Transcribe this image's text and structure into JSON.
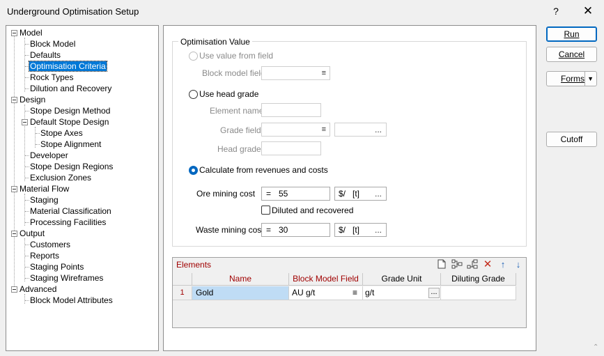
{
  "window": {
    "title": "Underground Optimisation Setup",
    "help_label": "?",
    "close_label": "✕"
  },
  "tree": {
    "model": "Model",
    "block_model": "Block Model",
    "defaults": "Defaults",
    "optimisation_criteria": "Optimisation Criteria",
    "rock_types": "Rock Types",
    "dilution_and_recovery": "Dilution and Recovery",
    "design": "Design",
    "stope_design_method": "Stope Design Method",
    "default_stope_design": "Default Stope Design",
    "stope_axes": "Stope Axes",
    "stope_alignment": "Stope Alignment",
    "developer": "Developer",
    "stope_design_regions": "Stope Design Regions",
    "exclusion_zones": "Exclusion Zones",
    "material_flow": "Material Flow",
    "staging": "Staging",
    "material_classification": "Material Classification",
    "processing_facilities": "Processing Facilities",
    "output": "Output",
    "customers": "Customers",
    "reports": "Reports",
    "staging_points": "Staging Points",
    "staging_wireframes": "Staging Wireframes",
    "advanced": "Advanced",
    "block_model_attributes": "Block Model Attributes"
  },
  "optimisation": {
    "group_title": "Optimisation Value",
    "use_value_from_field": "Use value from field",
    "block_model_field_label": "Block model field",
    "use_head_grade": "Use head grade",
    "element_name_label": "Element name",
    "grade_field_label": "Grade field",
    "head_grade_label": "Head grade",
    "calculate_from_revenues": "Calculate from revenues and costs",
    "ore_mining_cost_label": "Ore mining cost",
    "ore_mining_cost_op": "=",
    "ore_mining_cost_value": "55",
    "ore_unit_currency": "$/",
    "ore_unit_mass": "[t]",
    "diluted_and_recovered": "Diluted and recovered",
    "waste_mining_cost_label": "Waste mining cost",
    "waste_mining_cost_op": "=",
    "waste_mining_cost_value": "30",
    "waste_unit_currency": "$/",
    "waste_unit_mass": "[t]",
    "ellipsis": "..."
  },
  "elements": {
    "title": "Elements",
    "columns": [
      "Name",
      "Block Model Field",
      "Grade Unit",
      "Diluting Grade"
    ],
    "rows": [
      {
        "index": "1",
        "name": "Gold",
        "block_model_field": "AU g/t",
        "grade_unit": "g/t",
        "diluting_grade": ""
      }
    ]
  },
  "buttons": {
    "run": "Run",
    "cancel": "Cancel",
    "forms": "Forms",
    "cutoff": "Cutoff"
  },
  "colors": {
    "accent": "#0067c0",
    "selection": "#0078d7",
    "grid_header_red": "#a00000",
    "name_cell": "#bfdcf5"
  }
}
